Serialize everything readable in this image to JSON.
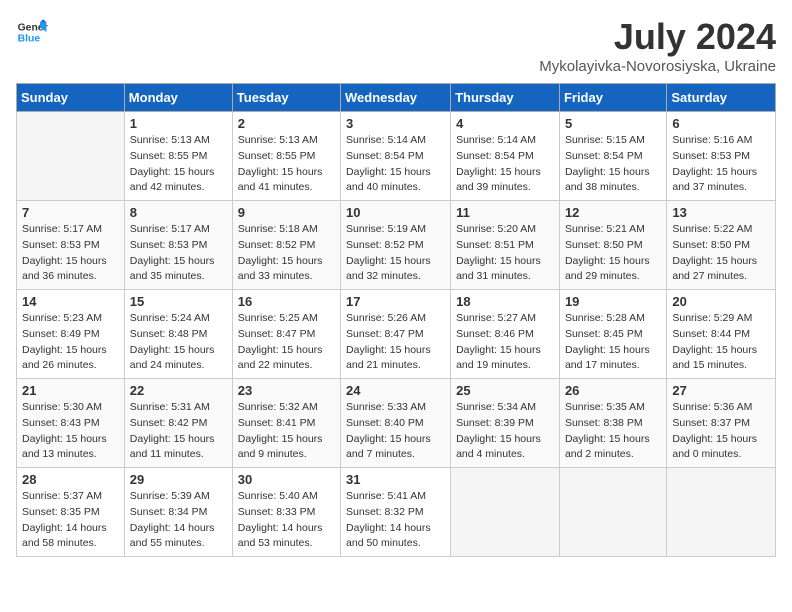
{
  "header": {
    "logo_line1": "General",
    "logo_line2": "Blue",
    "month": "July 2024",
    "location": "Mykolayivka-Novorosiyska, Ukraine"
  },
  "days_of_week": [
    "Sunday",
    "Monday",
    "Tuesday",
    "Wednesday",
    "Thursday",
    "Friday",
    "Saturday"
  ],
  "weeks": [
    [
      {
        "num": "",
        "lines": []
      },
      {
        "num": "1",
        "lines": [
          "Sunrise: 5:13 AM",
          "Sunset: 8:55 PM",
          "Daylight: 15 hours",
          "and 42 minutes."
        ]
      },
      {
        "num": "2",
        "lines": [
          "Sunrise: 5:13 AM",
          "Sunset: 8:55 PM",
          "Daylight: 15 hours",
          "and 41 minutes."
        ]
      },
      {
        "num": "3",
        "lines": [
          "Sunrise: 5:14 AM",
          "Sunset: 8:54 PM",
          "Daylight: 15 hours",
          "and 40 minutes."
        ]
      },
      {
        "num": "4",
        "lines": [
          "Sunrise: 5:14 AM",
          "Sunset: 8:54 PM",
          "Daylight: 15 hours",
          "and 39 minutes."
        ]
      },
      {
        "num": "5",
        "lines": [
          "Sunrise: 5:15 AM",
          "Sunset: 8:54 PM",
          "Daylight: 15 hours",
          "and 38 minutes."
        ]
      },
      {
        "num": "6",
        "lines": [
          "Sunrise: 5:16 AM",
          "Sunset: 8:53 PM",
          "Daylight: 15 hours",
          "and 37 minutes."
        ]
      }
    ],
    [
      {
        "num": "7",
        "lines": [
          "Sunrise: 5:17 AM",
          "Sunset: 8:53 PM",
          "Daylight: 15 hours",
          "and 36 minutes."
        ]
      },
      {
        "num": "8",
        "lines": [
          "Sunrise: 5:17 AM",
          "Sunset: 8:53 PM",
          "Daylight: 15 hours",
          "and 35 minutes."
        ]
      },
      {
        "num": "9",
        "lines": [
          "Sunrise: 5:18 AM",
          "Sunset: 8:52 PM",
          "Daylight: 15 hours",
          "and 33 minutes."
        ]
      },
      {
        "num": "10",
        "lines": [
          "Sunrise: 5:19 AM",
          "Sunset: 8:52 PM",
          "Daylight: 15 hours",
          "and 32 minutes."
        ]
      },
      {
        "num": "11",
        "lines": [
          "Sunrise: 5:20 AM",
          "Sunset: 8:51 PM",
          "Daylight: 15 hours",
          "and 31 minutes."
        ]
      },
      {
        "num": "12",
        "lines": [
          "Sunrise: 5:21 AM",
          "Sunset: 8:50 PM",
          "Daylight: 15 hours",
          "and 29 minutes."
        ]
      },
      {
        "num": "13",
        "lines": [
          "Sunrise: 5:22 AM",
          "Sunset: 8:50 PM",
          "Daylight: 15 hours",
          "and 27 minutes."
        ]
      }
    ],
    [
      {
        "num": "14",
        "lines": [
          "Sunrise: 5:23 AM",
          "Sunset: 8:49 PM",
          "Daylight: 15 hours",
          "and 26 minutes."
        ]
      },
      {
        "num": "15",
        "lines": [
          "Sunrise: 5:24 AM",
          "Sunset: 8:48 PM",
          "Daylight: 15 hours",
          "and 24 minutes."
        ]
      },
      {
        "num": "16",
        "lines": [
          "Sunrise: 5:25 AM",
          "Sunset: 8:47 PM",
          "Daylight: 15 hours",
          "and 22 minutes."
        ]
      },
      {
        "num": "17",
        "lines": [
          "Sunrise: 5:26 AM",
          "Sunset: 8:47 PM",
          "Daylight: 15 hours",
          "and 21 minutes."
        ]
      },
      {
        "num": "18",
        "lines": [
          "Sunrise: 5:27 AM",
          "Sunset: 8:46 PM",
          "Daylight: 15 hours",
          "and 19 minutes."
        ]
      },
      {
        "num": "19",
        "lines": [
          "Sunrise: 5:28 AM",
          "Sunset: 8:45 PM",
          "Daylight: 15 hours",
          "and 17 minutes."
        ]
      },
      {
        "num": "20",
        "lines": [
          "Sunrise: 5:29 AM",
          "Sunset: 8:44 PM",
          "Daylight: 15 hours",
          "and 15 minutes."
        ]
      }
    ],
    [
      {
        "num": "21",
        "lines": [
          "Sunrise: 5:30 AM",
          "Sunset: 8:43 PM",
          "Daylight: 15 hours",
          "and 13 minutes."
        ]
      },
      {
        "num": "22",
        "lines": [
          "Sunrise: 5:31 AM",
          "Sunset: 8:42 PM",
          "Daylight: 15 hours",
          "and 11 minutes."
        ]
      },
      {
        "num": "23",
        "lines": [
          "Sunrise: 5:32 AM",
          "Sunset: 8:41 PM",
          "Daylight: 15 hours",
          "and 9 minutes."
        ]
      },
      {
        "num": "24",
        "lines": [
          "Sunrise: 5:33 AM",
          "Sunset: 8:40 PM",
          "Daylight: 15 hours",
          "and 7 minutes."
        ]
      },
      {
        "num": "25",
        "lines": [
          "Sunrise: 5:34 AM",
          "Sunset: 8:39 PM",
          "Daylight: 15 hours",
          "and 4 minutes."
        ]
      },
      {
        "num": "26",
        "lines": [
          "Sunrise: 5:35 AM",
          "Sunset: 8:38 PM",
          "Daylight: 15 hours",
          "and 2 minutes."
        ]
      },
      {
        "num": "27",
        "lines": [
          "Sunrise: 5:36 AM",
          "Sunset: 8:37 PM",
          "Daylight: 15 hours",
          "and 0 minutes."
        ]
      }
    ],
    [
      {
        "num": "28",
        "lines": [
          "Sunrise: 5:37 AM",
          "Sunset: 8:35 PM",
          "Daylight: 14 hours",
          "and 58 minutes."
        ]
      },
      {
        "num": "29",
        "lines": [
          "Sunrise: 5:39 AM",
          "Sunset: 8:34 PM",
          "Daylight: 14 hours",
          "and 55 minutes."
        ]
      },
      {
        "num": "30",
        "lines": [
          "Sunrise: 5:40 AM",
          "Sunset: 8:33 PM",
          "Daylight: 14 hours",
          "and 53 minutes."
        ]
      },
      {
        "num": "31",
        "lines": [
          "Sunrise: 5:41 AM",
          "Sunset: 8:32 PM",
          "Daylight: 14 hours",
          "and 50 minutes."
        ]
      },
      {
        "num": "",
        "lines": []
      },
      {
        "num": "",
        "lines": []
      },
      {
        "num": "",
        "lines": []
      }
    ]
  ]
}
